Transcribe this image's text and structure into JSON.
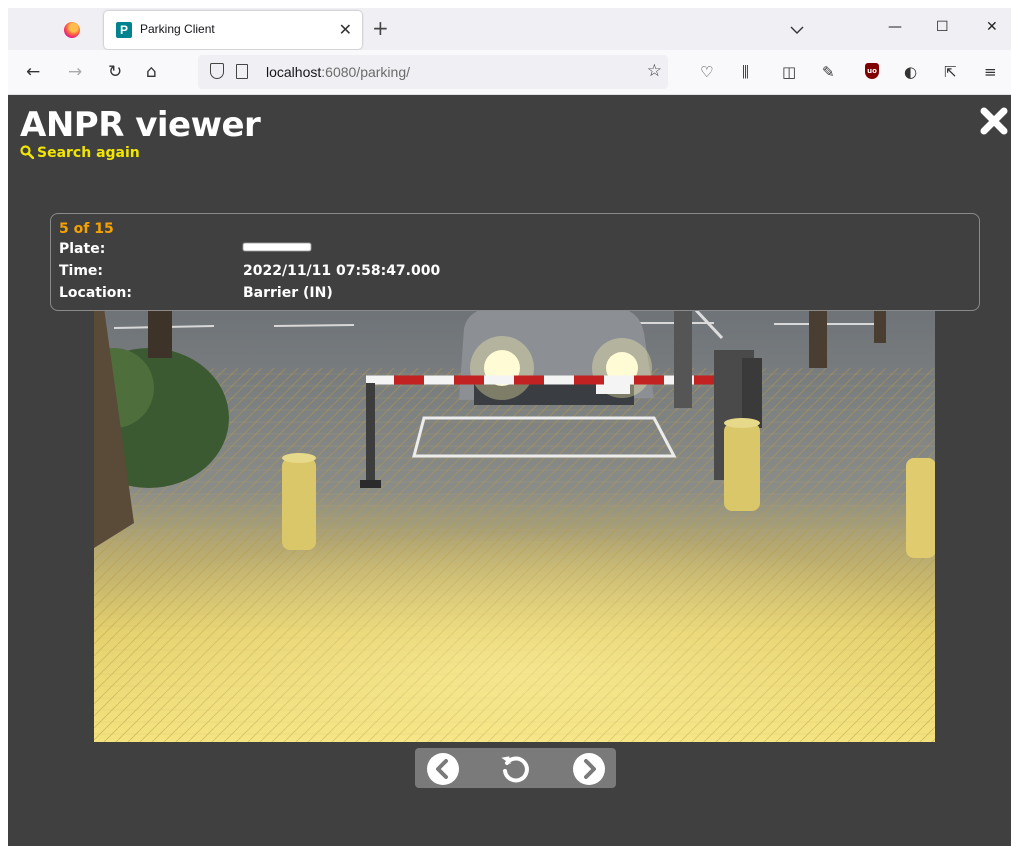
{
  "browser": {
    "tab_title": "Parking Client",
    "tab_favicon_letter": "P",
    "url_host": "localhost",
    "url_rest": ":6080/parking/",
    "icons": [
      "firefox-logo-icon",
      "close-icon",
      "plus-icon",
      "chevron-down-icon",
      "minimize-icon",
      "maximize-icon",
      "close-icon",
      "back-icon",
      "forward-icon",
      "reload-icon",
      "home-icon",
      "shield-icon",
      "page-icon",
      "star-icon",
      "pocket-icon",
      "library-icon",
      "sidebar-icon",
      "extension-icon",
      "ublock-icon",
      "privacy-icon",
      "share-icon",
      "menu-icon"
    ]
  },
  "app": {
    "title": "ANPR viewer",
    "search_again": "Search again",
    "close_icon": "close-icon"
  },
  "record": {
    "counter": "5 of 15",
    "plate_label": "Plate:",
    "plate_value": "",
    "time_label": "Time:",
    "time_value": "2022/11/11 07:58:47.000",
    "location_label": "Location:",
    "location_value": "Barrier (IN)"
  },
  "navigation": {
    "prev_icon": "chevron-left-circle-icon",
    "rotate_icon": "rotate-ccw-icon",
    "next_icon": "chevron-right-circle-icon"
  },
  "colors": {
    "page_bg": "#404040",
    "accent_yellow": "#f2e600",
    "counter_orange": "#f5a200"
  }
}
